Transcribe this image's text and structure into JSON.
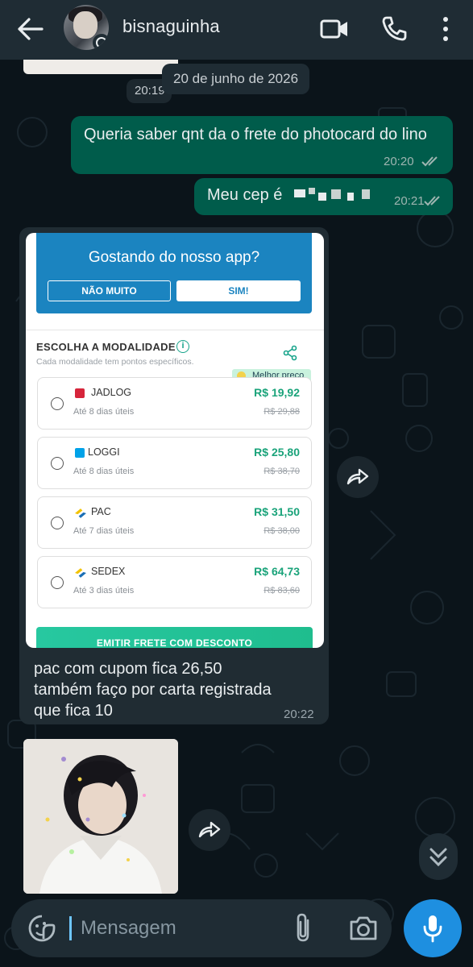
{
  "header": {
    "contact_name": "bisnaguinha",
    "icons": [
      "back-arrow-icon",
      "video-call-icon",
      "voice-call-icon",
      "more-options-icon"
    ]
  },
  "chat": {
    "date_chip": "20 de junho de 2026",
    "top_image_time": "20:19",
    "messages": [
      {
        "direction": "out",
        "text": "Queria saber qnt da o frete do photocard do lino",
        "time": "20:20",
        "status": "read"
      },
      {
        "direction": "out",
        "text": "Meu cep é",
        "time": "20:21",
        "status": "read"
      },
      {
        "direction": "in",
        "text_lines": [
          "pac com cupom fica 26,50",
          "também faço por carta registrada",
          "que fica 10"
        ],
        "time": "20:22"
      }
    ],
    "shipping_screenshot": {
      "banner_title": "Gostando do nosso app?",
      "banner_no": "NÃO MUITO",
      "banner_yes": "SIM!",
      "section_title": "ESCOLHA A MODALIDADE",
      "section_subtitle": "Cada modalidade tem pontos específicos.",
      "best_price_tag": "Melhor preço",
      "options": [
        {
          "carrier": "JADLOG",
          "days": "Até 8 dias úteis",
          "price": "R$ 19,92",
          "old_price": "R$ 29,88",
          "logo_color": "#d6253b"
        },
        {
          "carrier": "LOGGI",
          "days": "Até 8 dias úteis",
          "price": "R$ 25,80",
          "old_price": "R$ 38,70",
          "logo_color": "#00a2e8"
        },
        {
          "carrier": "PAC",
          "days": "Até 7 dias úteis",
          "price": "R$ 31,50",
          "old_price": "R$ 38,00",
          "logo_color": "#f2c200"
        },
        {
          "carrier": "SEDEX",
          "days": "Até 3 dias úteis",
          "price": "R$ 64,73",
          "old_price": "R$ 83,60",
          "logo_color": "#f2c200"
        }
      ],
      "emit_button": "EMITIR FRETE COM DESCONTO"
    }
  },
  "composer": {
    "placeholder": "Mensagem",
    "icons": [
      "sticker-icon",
      "attach-icon",
      "camera-icon",
      "mic-icon"
    ]
  },
  "colors": {
    "background": "#0b141a",
    "header": "#1f2c34",
    "outgoing_bubble": "#005c4b",
    "incoming_bubble": "#202c33",
    "accent_blue": "#1e8fe0",
    "price_green": "#1aa37a"
  }
}
